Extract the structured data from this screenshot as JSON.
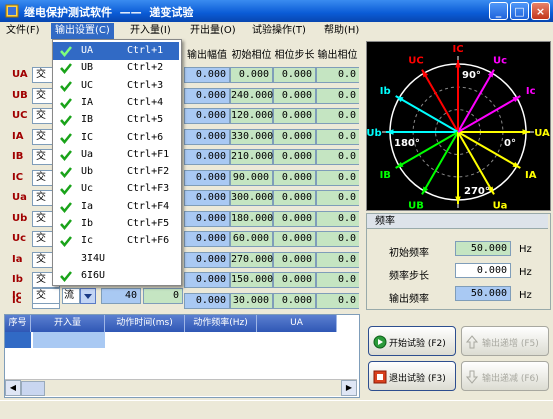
{
  "window": {
    "title": "继电保护测试软件  ——  递变试验"
  },
  "menu": [
    {
      "label": "文件(F)",
      "active": false
    },
    {
      "label": "输出设置(C)",
      "active": true
    },
    {
      "label": "开入量(I)",
      "active": false
    },
    {
      "label": "开出量(O)",
      "active": false
    },
    {
      "label": "试验操作(T)",
      "active": false
    },
    {
      "label": "帮助(H)",
      "active": false
    }
  ],
  "dropdown": [
    {
      "label": "UA",
      "shortcut": "Ctrl+1",
      "checked": true,
      "selected": true
    },
    {
      "label": "UB",
      "shortcut": "Ctrl+2",
      "checked": true
    },
    {
      "label": "UC",
      "shortcut": "Ctrl+3",
      "checked": true
    },
    {
      "label": "IA",
      "shortcut": "Ctrl+4",
      "checked": true
    },
    {
      "label": "IB",
      "shortcut": "Ctrl+5",
      "checked": true
    },
    {
      "label": "IC",
      "shortcut": "Ctrl+6",
      "checked": true
    },
    {
      "label": "Ua",
      "shortcut": "Ctrl+F1",
      "checked": true
    },
    {
      "label": "Ub",
      "shortcut": "Ctrl+F2",
      "checked": true
    },
    {
      "label": "Uc",
      "shortcut": "Ctrl+F3",
      "checked": true
    },
    {
      "label": "Ia",
      "shortcut": "Ctrl+F4",
      "checked": true
    },
    {
      "label": "Ib",
      "shortcut": "Ctrl+F5",
      "checked": true
    },
    {
      "label": "Ic",
      "shortcut": "Ctrl+F6",
      "checked": true
    },
    {
      "label": "3I4U",
      "shortcut": "",
      "checked": false
    },
    {
      "label": "6I6U",
      "shortcut": "",
      "checked": true
    }
  ],
  "grid": {
    "headers": [
      "输出幅值",
      "初始相位",
      "相位步长",
      "输出相位"
    ],
    "rows": [
      {
        "name": "UA",
        "type": "交",
        "amp": "0.000",
        "phase": "0.000",
        "step": "0.000",
        "out": "0.0"
      },
      {
        "name": "UB",
        "type": "交",
        "amp": "0.000",
        "phase": "240.000",
        "step": "0.000",
        "out": "0.0"
      },
      {
        "name": "UC",
        "type": "交",
        "amp": "0.000",
        "phase": "120.000",
        "step": "0.000",
        "out": "0.0"
      },
      {
        "name": "IA",
        "type": "交",
        "amp": "0.000",
        "phase": "330.000",
        "step": "0.000",
        "out": "0.0"
      },
      {
        "name": "IB",
        "type": "交",
        "amp": "0.000",
        "phase": "210.000",
        "step": "0.000",
        "out": "0.0"
      },
      {
        "name": "IC",
        "type": "交",
        "amp": "0.000",
        "phase": "90.000",
        "step": "0.000",
        "out": "0.0"
      },
      {
        "name": "Ua",
        "type": "交",
        "amp": "0.000",
        "phase": "300.000",
        "step": "0.000",
        "out": "0.0"
      },
      {
        "name": "Ub",
        "type": "交",
        "amp": "0.000",
        "phase": "180.000",
        "step": "0.000",
        "out": "0.0"
      },
      {
        "name": "Uc",
        "type": "交",
        "amp": "0.000",
        "phase": "60.000",
        "step": "0.000",
        "out": "0.0"
      },
      {
        "name": "Ia",
        "type": "交",
        "amp": "0.000",
        "phase": "270.000",
        "step": "0.000",
        "out": "0.0"
      },
      {
        "name": "Ib",
        "type": "交",
        "amp": "0.000",
        "phase": "150.000",
        "step": "0.000",
        "out": "0.0"
      },
      {
        "name": "Ic",
        "type": "交",
        "amp": "0.000",
        "phase": "30.000",
        "step": "0.000",
        "out": "0.0"
      }
    ],
    "bottom": {
      "type": "交",
      "mode": "流",
      "v1": "40",
      "v2": "0",
      "v3": "0"
    }
  },
  "phasor": {
    "angle_labels": [
      "90°",
      "0°",
      "180°",
      "270°"
    ],
    "vectors": [
      {
        "label": "UA",
        "angle": 0,
        "color": "#ffff00"
      },
      {
        "label": "Uc",
        "angle": 60,
        "color": "#ff00ff"
      },
      {
        "label": "IC",
        "angle": 90,
        "color": "#ff0000"
      },
      {
        "label": "UC",
        "angle": 120,
        "color": "#ff0000"
      },
      {
        "label": "Ib",
        "angle": 150,
        "color": "#00ffff"
      },
      {
        "label": "Ub",
        "angle": 180,
        "color": "#00ffff"
      },
      {
        "label": "IB",
        "angle": 210,
        "color": "#00ff00"
      },
      {
        "label": "UB",
        "angle": 240,
        "color": "#00ff00"
      },
      {
        "label": "Ia",
        "angle": 270,
        "color": "#ffff00"
      },
      {
        "label": "Ua",
        "angle": 300,
        "color": "#ffff00"
      },
      {
        "label": "IA",
        "angle": 330,
        "color": "#ffff00"
      },
      {
        "label": "Ic",
        "angle": 30,
        "color": "#ff00ff"
      }
    ]
  },
  "freq": {
    "title": "频率",
    "rows": [
      {
        "label": "初始频率",
        "value": "50.000",
        "unit": "Hz"
      },
      {
        "label": "频率步长",
        "value": "0.000",
        "unit": "Hz"
      },
      {
        "label": "输出频率",
        "value": "50.000",
        "unit": "Hz"
      }
    ]
  },
  "table": {
    "headers": [
      "序号",
      "开入量",
      "动作时间(ms)",
      "动作频率(Hz)",
      "UA"
    ]
  },
  "buttons": {
    "start": "开始试验 (F2)",
    "up": "输出递增 (F5)",
    "stop": "退出试验 (F3)",
    "down": "输出递减 (F6)"
  },
  "colors": {
    "title_bar": "#0a5bd6",
    "selection": "#316ac5",
    "amp_cell": "#a9c9f3",
    "phase_cell": "#c5e5c2"
  }
}
